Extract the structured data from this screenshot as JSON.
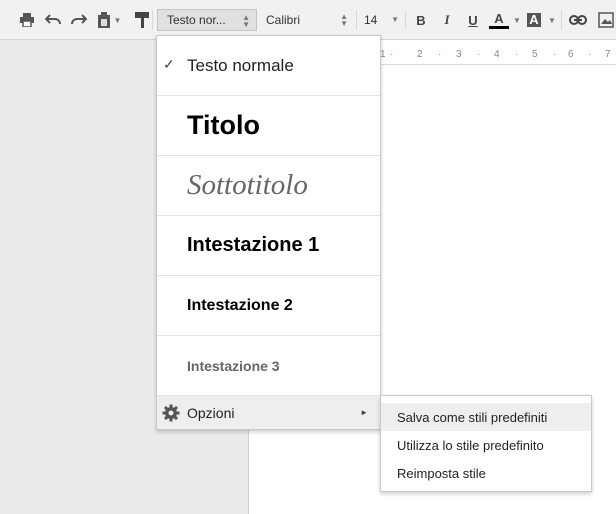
{
  "toolbar": {
    "style_select": "Testo nor...",
    "font_select": "Calibri",
    "size_select": "14",
    "bold": "B",
    "italic": "I",
    "underline": "U",
    "text_color": "A",
    "highlight": "A",
    "icons": [
      "print-icon",
      "undo-icon",
      "redo-icon",
      "paint-format-icon",
      "paint-roller-icon",
      "link-icon",
      "image-icon"
    ]
  },
  "ruler": {
    "ticks": [
      "1",
      "2",
      "3",
      "4",
      "5",
      "6",
      "7"
    ]
  },
  "style_menu": {
    "items": [
      {
        "label": "Testo normale",
        "checked": "✓"
      },
      {
        "label": "Titolo"
      },
      {
        "label": "Sottotitolo"
      },
      {
        "label": "Intestazione 1"
      },
      {
        "label": "Intestazione 2"
      },
      {
        "label": "Intestazione 3"
      }
    ],
    "options_label": "Opzioni",
    "options_arrow": "►"
  },
  "options_submenu": {
    "items": [
      "Salva come stili predefiniti",
      "Utilizza lo stile predefinito",
      "Reimposta stile"
    ]
  },
  "colors": {
    "toolbar_bg": "#f1f1f1",
    "menu_highlight": "#eeeeee",
    "page_gutter": "#ebebeb"
  }
}
